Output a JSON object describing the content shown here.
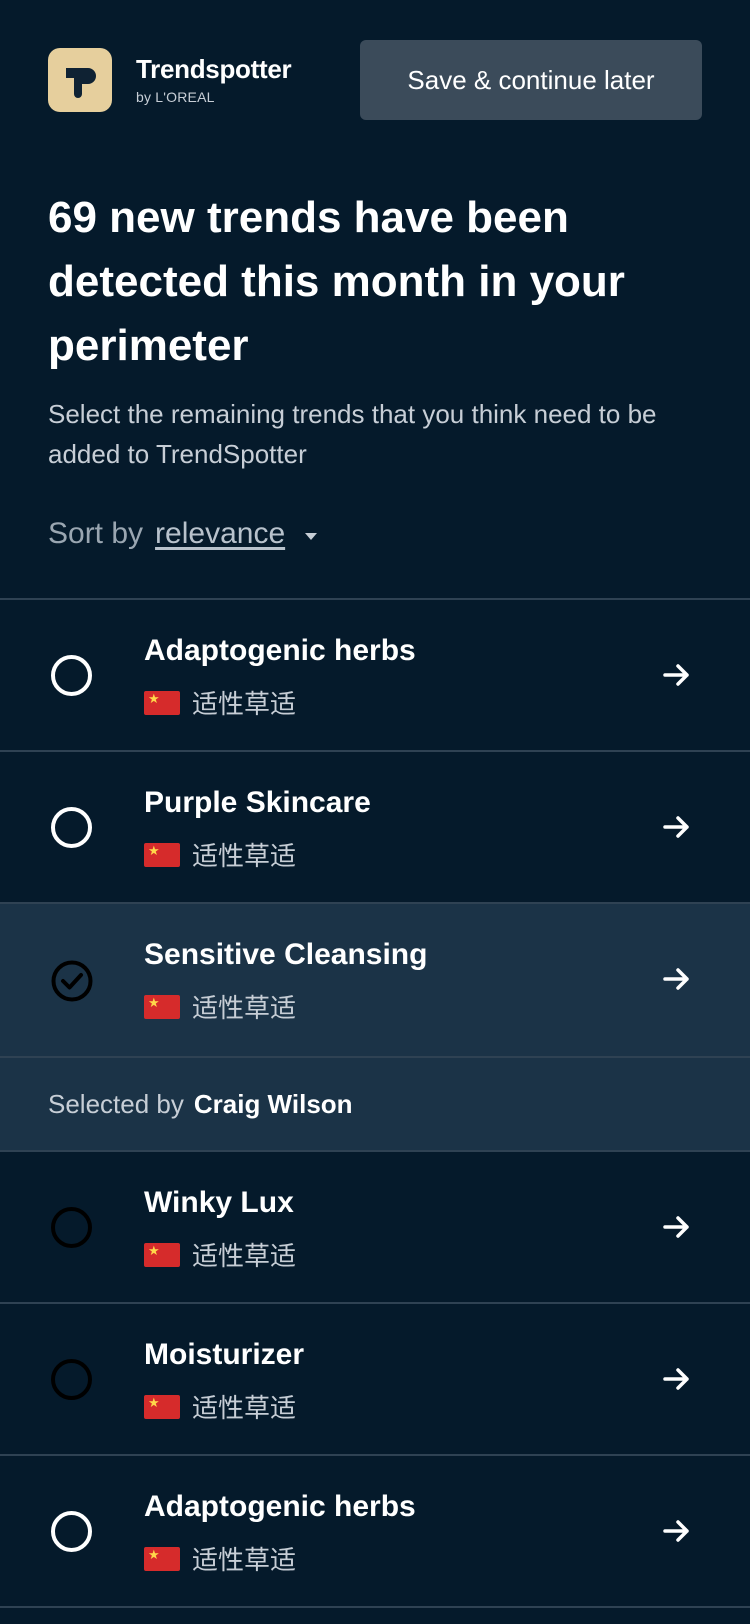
{
  "header": {
    "brand_name": "Trendspotter",
    "brand_sub": "by L'OREAL",
    "save_label": "Save & continue later",
    "logo_icon": "trendspotter-logo-icon"
  },
  "headline": "69 new trends have been detected this month in your perimeter",
  "subtitle": "Select the remaining trends that you think need to be added to TrendSpotter",
  "sort": {
    "label": "Sort by",
    "value": "relevance"
  },
  "trends": [
    {
      "title": "Adaptogenic herbs",
      "subtitle": "适性草适",
      "flag": "china-flag-icon",
      "selected": false
    },
    {
      "title": "Purple Skincare",
      "subtitle": "适性草适",
      "flag": "china-flag-icon",
      "selected": false
    },
    {
      "title": "Sensitive Cleansing",
      "subtitle": "适性草适",
      "flag": "china-flag-icon",
      "selected": true
    },
    {
      "title": "Winky Lux",
      "subtitle": "适性草适",
      "flag": "china-flag-icon",
      "selected": false
    },
    {
      "title": "Moisturizer",
      "subtitle": "适性草适",
      "flag": "china-flag-icon",
      "selected": false
    },
    {
      "title": "Adaptogenic herbs",
      "subtitle": "适性草适",
      "flag": "china-flag-icon",
      "selected": false
    }
  ],
  "selected_by": {
    "label": "Selected by",
    "name": "Craig Wilson"
  },
  "colors": {
    "background": "#051a2b",
    "selected_row": "#1b3347",
    "button": "#3b4b5a",
    "logo_tile": "#e6cf9d"
  }
}
